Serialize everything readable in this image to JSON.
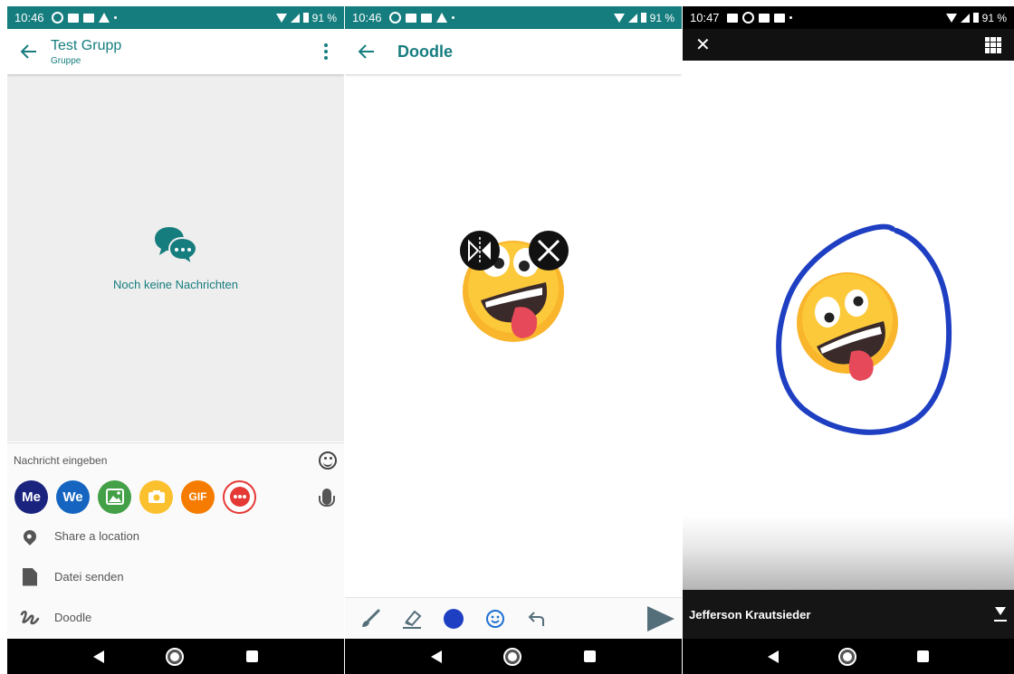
{
  "screens": {
    "chat": {
      "status": {
        "time": "10:46",
        "battery": "91 %"
      },
      "header": {
        "title": "Test Grupp",
        "subtitle": "Gruppe"
      },
      "empty_state": {
        "text": "Noch keine Nachrichten"
      },
      "composer": {
        "placeholder": "Nachricht eingeben",
        "quick_buttons": [
          {
            "label": "Me",
            "color": "#1a237e"
          },
          {
            "label": "We",
            "color": "#1565c0"
          },
          {
            "icon": "image-icon",
            "color": "#43a047"
          },
          {
            "icon": "camera-icon",
            "color": "#fbc02d"
          },
          {
            "label": "GIF",
            "color": "#f57c00"
          },
          {
            "icon": "more-icon",
            "color": "#e53935"
          }
        ]
      },
      "attach_menu": [
        {
          "icon": "location-pin-icon",
          "label": "Share a location"
        },
        {
          "icon": "file-icon",
          "label": "Datei senden"
        },
        {
          "icon": "doodle-icon",
          "label": "Doodle"
        }
      ]
    },
    "doodle": {
      "status": {
        "time": "10:46",
        "battery": "91 %"
      },
      "header": {
        "title": "Doodle"
      },
      "toolbar": {
        "tools": [
          "brush-icon",
          "eraser-icon",
          "color-picker",
          "emoji-icon",
          "undo-icon"
        ],
        "selected_color": "#1e3fc2"
      }
    },
    "viewer": {
      "status": {
        "time": "10:47",
        "battery": "91 %"
      },
      "footer": {
        "sender": "Jefferson Krautsieder"
      },
      "stroke_color": "#1e3fc2"
    }
  },
  "theme": {
    "accent": "#167d7f"
  }
}
